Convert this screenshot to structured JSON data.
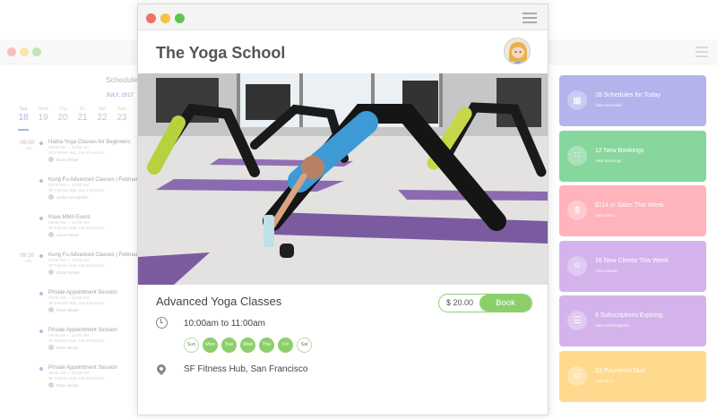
{
  "background_window": {
    "schedule_title": "Schedule",
    "month": "JULY, 2017",
    "days": [
      {
        "name": "Tue",
        "date": "18",
        "active": true
      },
      {
        "name": "Wed",
        "date": "19",
        "active": false
      },
      {
        "name": "Thu",
        "date": "20",
        "active": false
      },
      {
        "name": "Fri",
        "date": "21",
        "active": false
      },
      {
        "name": "Sat",
        "date": "22",
        "active": false
      },
      {
        "name": "Sun",
        "date": "23",
        "active": false
      }
    ],
    "time_slots": [
      {
        "time": "09:00",
        "period": "AM"
      },
      {
        "time": "09:30",
        "period": "AM"
      }
    ],
    "events": [
      {
        "title": "Hatha Yoga Classes for Beginners",
        "time": "09:00 AM — 10:00 AM",
        "place": "SF Fitness Hub, San Francisco",
        "person": "Rose Winter"
      },
      {
        "title": "Kung Fu Advanced Classes | February",
        "time": "09:00 AM — 10:00 AM",
        "place": "SF Fitness Hub, San Francisco",
        "person": "Jackie Hernandez"
      },
      {
        "title": "Rave MMA Event",
        "time": "09:00 AM — 10:00 AM",
        "place": "SF Fitness Hub, San Francisco",
        "person": "Jason Meyer"
      },
      {
        "title": "Kung Fu Advanced Classes | February",
        "time": "09:00 AM — 10:00 AM",
        "place": "SF Fitness Hub, San Francisco",
        "person": "Bryan Winter"
      },
      {
        "title": "Private Appointment Session",
        "time": "09:00 AM — 10:00 AM",
        "place": "SF Fitness Hub, San Francisco",
        "person": "Rose Winter"
      },
      {
        "title": "Private Appointment Session",
        "time": "09:00 AM — 10:00 AM",
        "place": "SF Fitness Hub, San Francisco",
        "person": "Rose Winter"
      },
      {
        "title": "Private Appointment Session",
        "time": "09:00 AM — 10:00 AM",
        "place": "SF Fitness Hub, San Francisco",
        "person": "Rose Winter"
      }
    ]
  },
  "cards": [
    {
      "title": "28 Schedules for Today",
      "link": "View Schedule",
      "color": "#b3b4ec",
      "icon": "calendar-icon"
    },
    {
      "title": "12 New Bookings",
      "link": "View Bookings",
      "color": "#86d69e",
      "icon": "grid-icon"
    },
    {
      "title": "$114 in Sales This Week",
      "link": "View Sales",
      "color": "#ffb3bb",
      "icon": "money-bag-icon"
    },
    {
      "title": "16 New Clients This Week",
      "link": "View Clients",
      "color": "#d4b3ec",
      "icon": "clients-icon"
    },
    {
      "title": "6 Subscriptions Expiring",
      "link": "View Subscriptions",
      "color": "#d4b3ec",
      "icon": "subscriptions-icon"
    },
    {
      "title": "32 Payments Due",
      "link": "View Dues",
      "color": "#ffd98e",
      "icon": "payment-icon"
    }
  ],
  "main": {
    "brand": "The Yoga School",
    "class_title": "Advanced Yoga Classes",
    "price": "$ 20.00",
    "book_label": "Book",
    "time": "10:00am to 11:00am",
    "location": "SF Fitness Hub, San Francisco",
    "weekdays": [
      {
        "label": "Sun",
        "on": false
      },
      {
        "label": "Mon",
        "on": true
      },
      {
        "label": "Tue",
        "on": true
      },
      {
        "label": "Wed",
        "on": true
      },
      {
        "label": "Thu",
        "on": true
      },
      {
        "label": "Fri",
        "on": true
      },
      {
        "label": "Sat",
        "on": false
      }
    ],
    "accent": "#8ccf6a"
  }
}
